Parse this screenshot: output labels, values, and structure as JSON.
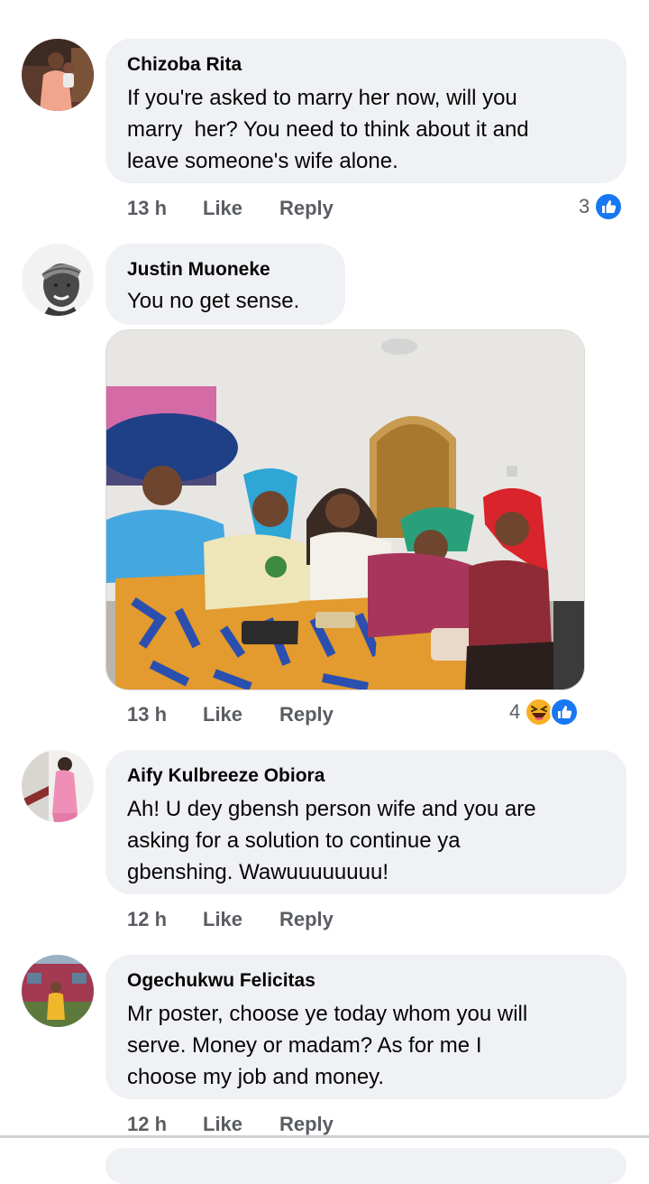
{
  "comments": [
    {
      "author": "Chizoba Rita",
      "text": "If you're asked to marry her now, will you\nmarry  her? You need to think about it and\nleave someone's wife alone.",
      "time": "13 h",
      "like_label": "Like",
      "reply_label": "Reply",
      "reaction_count": "3",
      "reaction_icons": [
        "like-icon"
      ]
    },
    {
      "author": "Justin Muoneke",
      "text": "You no get sense.",
      "time": "13 h",
      "like_label": "Like",
      "reply_label": "Reply",
      "reaction_count": "4",
      "reaction_icons": [
        "haha-icon",
        "like-icon"
      ]
    },
    {
      "author": "Aify Kulbreeze Obiora",
      "text": "Ah! U dey gbensh person wife and you are\nasking for a solution to continue ya\ngbenshing. Wawuuuuuuuu!",
      "time": "12 h",
      "like_label": "Like",
      "reply_label": "Reply"
    },
    {
      "author": "Ogechukwu Felicitas",
      "text": "Mr poster, choose ye today whom you will\nserve. Money or madam? As for me I\nchoose my job and money.",
      "time": "12 h",
      "like_label": "Like",
      "reply_label": "Reply"
    }
  ],
  "colors": {
    "bubble": "#eff1f4",
    "meta_text": "#5a5d62",
    "like_blue": "#1877f2",
    "haha_yellow": "#f7b125"
  }
}
